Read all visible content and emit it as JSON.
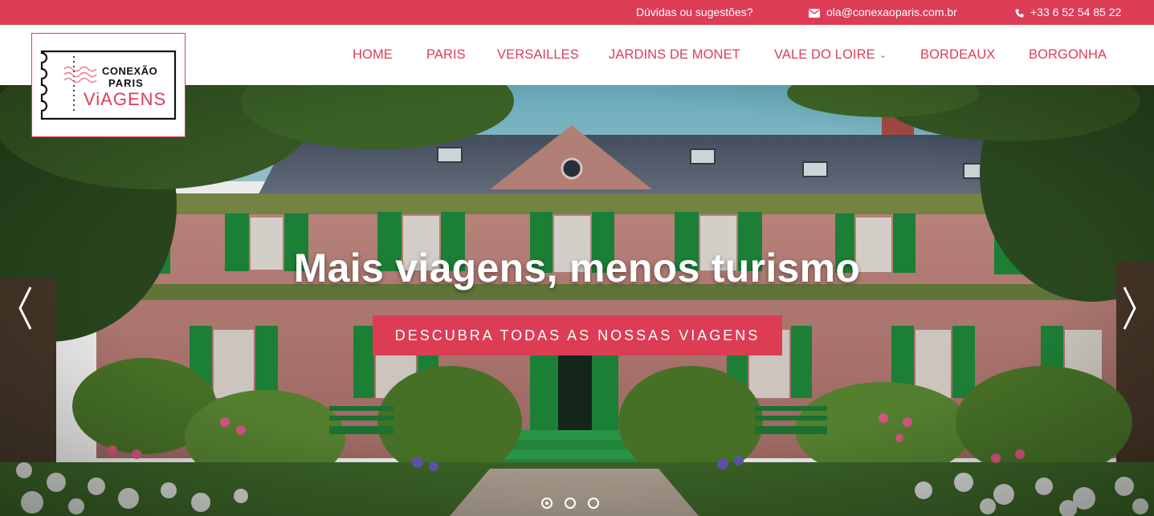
{
  "topbar": {
    "doubts": "Dúvidas ou sugestões?",
    "email": "ola@conexaoparis.com.br",
    "phone": "+33 6 52 54 85 22"
  },
  "logo": {
    "line1": "CONEXÃO",
    "line2": "PARIS",
    "line3": "ViAGENS"
  },
  "nav": {
    "items": [
      {
        "label": "HOME"
      },
      {
        "label": "PARIS"
      },
      {
        "label": "VERSAILLES"
      },
      {
        "label": "JARDINS DE MONET"
      },
      {
        "label": "VALE DO LOIRE",
        "dropdown": true
      },
      {
        "label": "BORDEAUX"
      },
      {
        "label": "BORGONHA"
      }
    ]
  },
  "hero": {
    "title": "Mais viagens, menos turismo",
    "button": "DESCUBRA TODAS AS NOSSAS VIAGENS",
    "slides": 3,
    "active_slide": 1
  },
  "colors": {
    "accent": "#dc3d55",
    "shutter_green": "#1f8a3b",
    "facade_pink": "#c98f86"
  },
  "icons": {
    "email": "envelope-icon",
    "phone": "phone-icon",
    "prev": "chevron-left-icon",
    "next": "chevron-right-icon",
    "dropdown": "chevron-down-icon"
  }
}
